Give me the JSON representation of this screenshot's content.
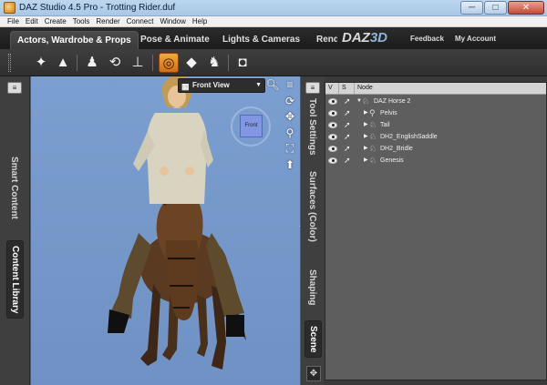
{
  "window": {
    "title": "DAZ Studio 4.5 Pro - Trotting Rider.duf",
    "minimize": "─",
    "maximize": "□",
    "close": "✕"
  },
  "menu": [
    "File",
    "Edit",
    "Create",
    "Tools",
    "Render",
    "Connect",
    "Window",
    "Help"
  ],
  "tabs": [
    {
      "label": "Actors, Wardrobe & Props",
      "active": true
    },
    {
      "label": "Pose & Animate",
      "active": false
    },
    {
      "label": "Lights & Cameras",
      "active": false
    },
    {
      "label": "Render",
      "active": false
    }
  ],
  "header": {
    "logo_text": "DAZ",
    "logo_suffix": "3D",
    "links": [
      "Feedback",
      "My Account"
    ]
  },
  "toolbar": {
    "tools": [
      {
        "name": "node-selection-tool-icon",
        "glyph": "✦",
        "active": false
      },
      {
        "name": "surface-selection-tool-icon",
        "glyph": "▲",
        "active": false
      },
      {
        "name": "universal-tool-icon",
        "glyph": "♟",
        "active": false
      },
      {
        "name": "rotate-tool-icon",
        "glyph": "⟲",
        "active": false
      },
      {
        "name": "translate-tool-icon",
        "glyph": "⊥",
        "active": false
      },
      {
        "name": "active-pose-tool-icon",
        "glyph": "◎",
        "active": true
      },
      {
        "name": "joint-editor-tool-icon",
        "glyph": "◆",
        "active": false
      },
      {
        "name": "figure-tool-icon",
        "glyph": "♞",
        "active": false
      },
      {
        "name": "render-camera-icon",
        "glyph": "◘",
        "active": false
      }
    ]
  },
  "left_pane": {
    "menu_glyph": "≡",
    "tabs": [
      {
        "label": "Smart Content",
        "selected": false
      },
      {
        "label": "Content Library",
        "selected": true
      }
    ]
  },
  "viewport": {
    "view_label": "Front View",
    "view_glyph": "▦",
    "dropdown_arrow": "▼",
    "cube_label": "Front",
    "handle_glyph": "◂"
  },
  "right_pane": {
    "menu_glyph": "≡",
    "tabs": [
      {
        "label": "Tool Settings",
        "selected": false
      },
      {
        "label": "Surfaces (Color)",
        "selected": false
      },
      {
        "label": "Shaping",
        "selected": false
      },
      {
        "label": "Scene",
        "selected": true
      }
    ],
    "columns": [
      "V",
      "S",
      "Node"
    ],
    "nodes": [
      {
        "label": "DAZ Horse 2",
        "level": 0,
        "expanded": true
      },
      {
        "label": "Pelvis",
        "level": 1,
        "expanded": false
      },
      {
        "label": "Tail",
        "level": 1,
        "expanded": false
      },
      {
        "label": "DH2_EnglishSaddle",
        "level": 1,
        "expanded": false
      },
      {
        "label": "DH2_Bridle",
        "level": 1,
        "expanded": false
      },
      {
        "label": "Genesis",
        "level": 1,
        "expanded": false
      }
    ],
    "grip_glyph": "✥"
  },
  "colors": {
    "accent_orange": "#e8861e",
    "viewport_bg": "#7496c8",
    "panel_dark": "#3a3a3a"
  }
}
